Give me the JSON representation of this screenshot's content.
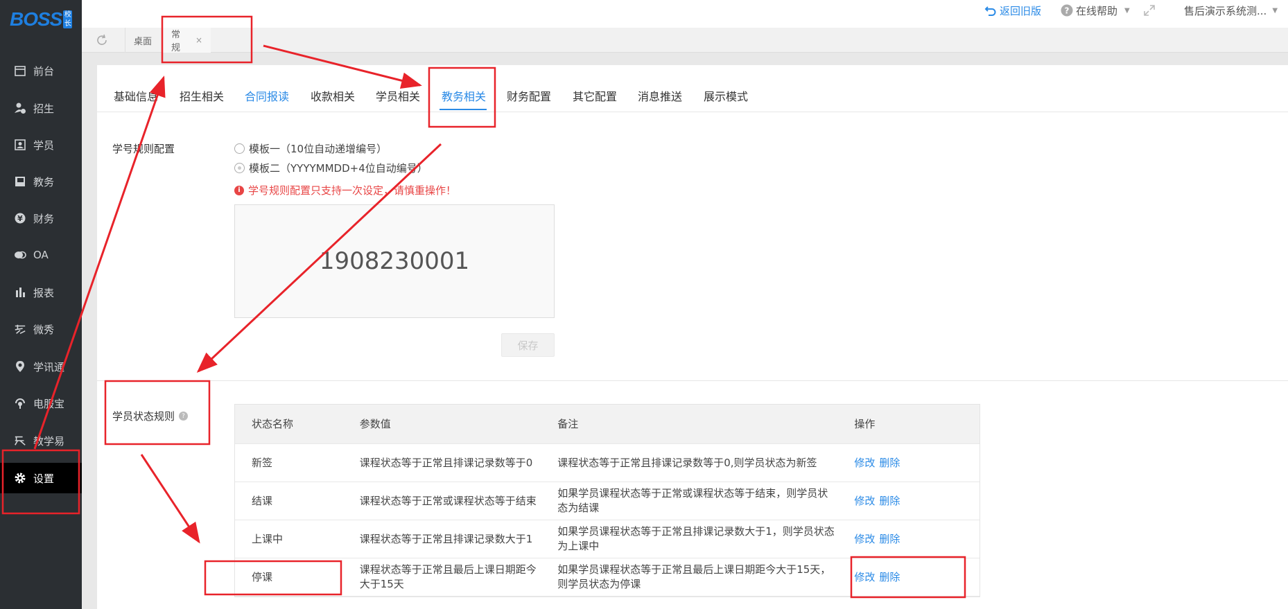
{
  "logo": {
    "text": "BOSS",
    "badge": "校长"
  },
  "sidebar": {
    "items": [
      {
        "label": "前台",
        "icon": "calendar-icon"
      },
      {
        "label": "招生",
        "icon": "user-add-icon"
      },
      {
        "label": "学员",
        "icon": "id-card-icon"
      },
      {
        "label": "教务",
        "icon": "book-icon"
      },
      {
        "label": "财务",
        "icon": "yen-icon"
      },
      {
        "label": "OA",
        "icon": "chat-icon"
      },
      {
        "label": "报表",
        "icon": "bar-chart-icon"
      },
      {
        "label": "微秀",
        "icon": "xiu-icon"
      },
      {
        "label": "学讯通",
        "icon": "location-icon"
      },
      {
        "label": "电服宝",
        "icon": "signal-icon"
      },
      {
        "label": "教学易",
        "icon": "teaching-icon"
      },
      {
        "label": "设置",
        "icon": "gear-icon"
      }
    ],
    "active": "设置"
  },
  "topbar": {
    "return_old": "返回旧版",
    "help": "在线帮助",
    "account": "售后演示系统测..."
  },
  "page_tabs": [
    {
      "label": "桌面"
    },
    {
      "label": "常规",
      "close": "×"
    }
  ],
  "subtabs": [
    {
      "label": "基础信息"
    },
    {
      "label": "招生相关"
    },
    {
      "label": "合同报读"
    },
    {
      "label": "收款相关"
    },
    {
      "label": "学员相关"
    },
    {
      "label": "教务相关"
    },
    {
      "label": "财务配置"
    },
    {
      "label": "其它配置"
    },
    {
      "label": "消息推送"
    },
    {
      "label": "展示模式"
    }
  ],
  "active_subtab": "教务相关",
  "student_no": {
    "label": "学号规则配置",
    "options": [
      "模板一（10位自动递增编号）",
      "模板二（YYYYMMDD+4位自动编号）"
    ],
    "selected": 1,
    "warning": "学号规则配置只支持一次设定，请慎重操作！",
    "preview": "1908230001",
    "save": "保存"
  },
  "status_rules": {
    "label": "学员状态规则",
    "headers": [
      "状态名称",
      "参数值",
      "备注",
      "操作"
    ],
    "rows": [
      {
        "name": "新签",
        "param": "课程状态等于正常且排课记录数等于0",
        "remark": "课程状态等于正常且排课记录数等于0,则学员状态为新签"
      },
      {
        "name": "结课",
        "param": "课程状态等于正常或课程状态等于结束",
        "remark": "如果学员课程状态等于正常或课程状态等于结束，则学员状态为结课"
      },
      {
        "name": "上课中",
        "param": "课程状态等于正常且排课记录数大于1",
        "remark": "如果学员课程状态等于正常且排课记录数大于1，则学员状态为上课中"
      },
      {
        "name": "停课",
        "param": "课程状态等于正常且最后上课日期距今大于15天",
        "remark": "如果学员课程状态等于正常且最后上课日期距今大于15天，则学员状态为停课"
      }
    ],
    "edit": "修改",
    "delete": "删除"
  },
  "colors": {
    "accent": "#2a8ae6",
    "sidebar_bg": "#2b2f33",
    "annotation": "#e8232a",
    "warning": "#e84545"
  }
}
